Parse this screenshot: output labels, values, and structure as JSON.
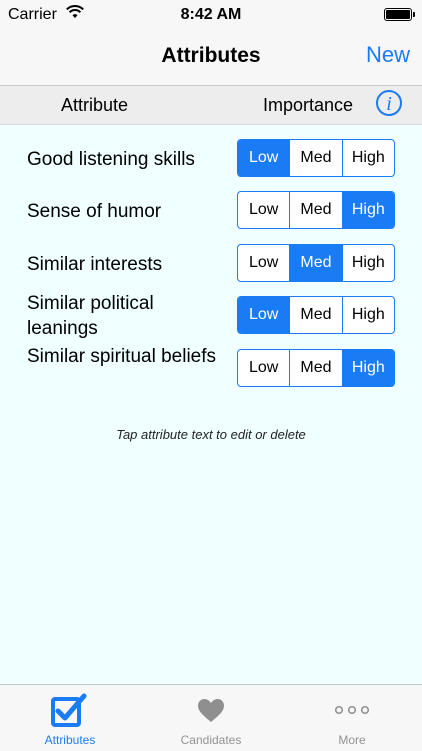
{
  "status": {
    "carrier": "Carrier",
    "time": "8:42 AM"
  },
  "nav": {
    "title": "Attributes",
    "new_label": "New"
  },
  "header": {
    "attribute": "Attribute",
    "importance": "Importance",
    "info": "i"
  },
  "rows": [
    {
      "label": "Good listening skills",
      "selected": "Low"
    },
    {
      "label": "Sense of humor",
      "selected": "High"
    },
    {
      "label": "Similar interests",
      "selected": "Med"
    },
    {
      "label": "Similar political leanings",
      "selected": "Low"
    },
    {
      "label": "Similar spiritual beliefs",
      "selected": "High"
    }
  ],
  "options": [
    "Low",
    "Med",
    "High"
  ],
  "hint": "Tap attribute text to edit or delete",
  "tabs": [
    {
      "label": "Attributes",
      "icon": "checkbox-icon",
      "active": true
    },
    {
      "label": "Candidates",
      "icon": "heart-icon",
      "active": false
    },
    {
      "label": "More",
      "icon": "more-icon",
      "active": false
    }
  ],
  "colors": {
    "accent": "#1a7cf5",
    "background": "#f0ffff",
    "inactive": "#929292"
  }
}
